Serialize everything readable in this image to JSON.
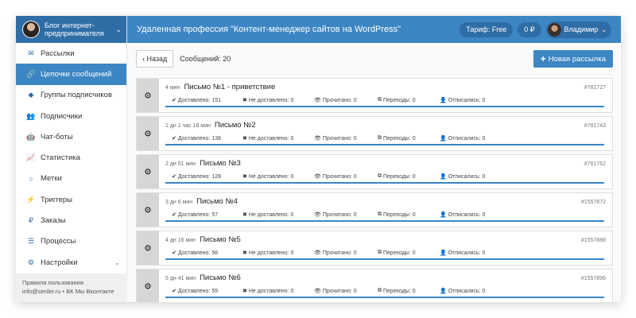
{
  "sidebar": {
    "brand_name": "Блог интернет-предпринимателя",
    "items": [
      {
        "icon": "envelope-icon",
        "glyph": "✉",
        "label": "Рассылки"
      },
      {
        "icon": "link-icon",
        "glyph": "🔗",
        "label": "Цепочки сообщений",
        "active": true
      },
      {
        "icon": "tags-icon",
        "glyph": "◆",
        "label": "Группы подписчиков"
      },
      {
        "icon": "users-icon",
        "glyph": "👥",
        "label": "Подписчики"
      },
      {
        "icon": "android-icon",
        "glyph": "🤖",
        "label": "Чат-боты"
      },
      {
        "icon": "chart-line-icon",
        "glyph": "📈",
        "label": "Статистика"
      },
      {
        "icon": "circle-icon",
        "glyph": "○",
        "label": "Метки"
      },
      {
        "icon": "bolt-icon",
        "glyph": "⚡",
        "label": "Триггеры"
      },
      {
        "icon": "ruble-icon",
        "glyph": "₽",
        "label": "Заказы"
      },
      {
        "icon": "tasks-icon",
        "glyph": "☰",
        "label": "Процессы"
      },
      {
        "icon": "cogs-icon",
        "glyph": "⚙",
        "label": "Настройки"
      }
    ],
    "footer_line1": "Правила пользования",
    "footer_line2": "info@senler.ru • ВК Мы Вконтакте"
  },
  "topbar": {
    "title": "Удаленная профессия \"Контент-менеджер сайтов на WordPress\"",
    "tariff": "Тариф: Free",
    "balance": "0 ₽",
    "user": "Владимир"
  },
  "toolbar": {
    "back_label": "‹ Назад",
    "count_label": "Сообщений: 20",
    "new_label": "Новая рассылка"
  },
  "stat_labels": {
    "delivered": "Доставлено:",
    "not_delivered": "Не доставлено:",
    "read": "Прочитано:",
    "clicks": "Переходы:",
    "unsub": "Отписались:"
  },
  "messages": [
    {
      "delay": "4 мин",
      "name": "Письмо №1 - приветствие",
      "id": "#781727",
      "delivered": 151,
      "not_delivered": 0,
      "read": 0,
      "clicks": 0,
      "unsub": 0
    },
    {
      "delay": "1 дн 1 час 18 мин",
      "name": "Письмо №2",
      "id": "#781743",
      "delivered": 138,
      "not_delivered": 0,
      "read": 0,
      "clicks": 0,
      "unsub": 0
    },
    {
      "delay": "2 дн 51 мин",
      "name": "Письмо №3",
      "id": "#781762",
      "delivered": 128,
      "not_delivered": 0,
      "read": 0,
      "clicks": 0,
      "unsub": 0
    },
    {
      "delay": "3 дн 6 мин",
      "name": "Письмо №4",
      "id": "#1557872",
      "delivered": 57,
      "not_delivered": 0,
      "read": 0,
      "clicks": 0,
      "unsub": 0
    },
    {
      "delay": "4 дн 16 мин",
      "name": "Письмо №5",
      "id": "#1557888",
      "delivered": 56,
      "not_delivered": 0,
      "read": 0,
      "clicks": 0,
      "unsub": 0
    },
    {
      "delay": "5 дн 41 мин",
      "name": "Письмо №6",
      "id": "#1557896",
      "delivered": 55,
      "not_delivered": 0,
      "read": 0,
      "clicks": 0,
      "unsub": 0
    }
  ],
  "colors": {
    "primary": "#3c86c4",
    "primary_dark": "#2f6da6"
  }
}
